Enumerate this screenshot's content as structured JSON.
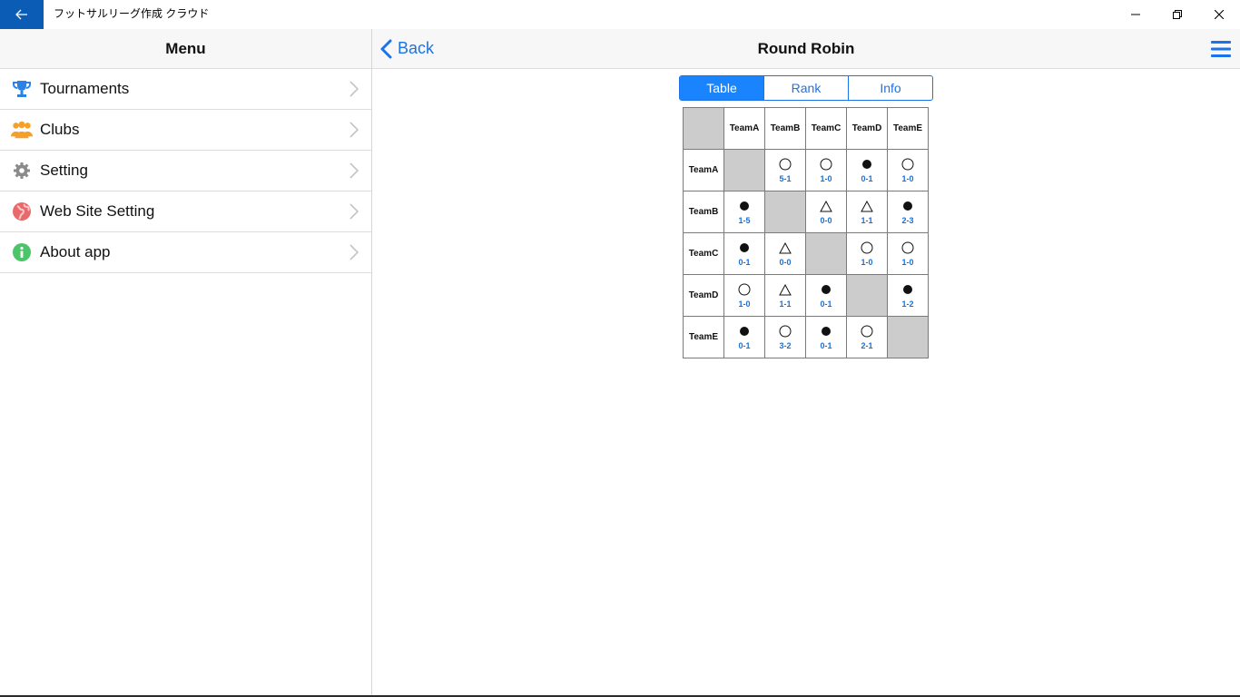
{
  "window": {
    "title": "フットサルリーグ作成 クラウド"
  },
  "menu": {
    "title": "Menu",
    "items": [
      {
        "label": "Tournaments",
        "icon": "trophy-icon",
        "color": "#2a82e4"
      },
      {
        "label": "Clubs",
        "icon": "people-icon",
        "color": "#f5a02a"
      },
      {
        "label": "Setting",
        "icon": "gear-icon",
        "color": "#8a8a8a"
      },
      {
        "label": "Web Site Setting",
        "icon": "globe-icon",
        "color": "#e86a6a"
      },
      {
        "label": "About app",
        "icon": "info-icon",
        "color": "#4cc46a"
      }
    ]
  },
  "nav": {
    "back_label": "Back",
    "title": "Round Robin"
  },
  "tabs": [
    {
      "label": "Table",
      "active": true
    },
    {
      "label": "Rank",
      "active": false
    },
    {
      "label": "Info",
      "active": false
    }
  ],
  "table": {
    "teams": [
      "TeamA",
      "TeamB",
      "TeamC",
      "TeamD",
      "TeamE"
    ],
    "rows": [
      [
        null,
        {
          "result": "win",
          "score": "5-1"
        },
        {
          "result": "win",
          "score": "1-0"
        },
        {
          "result": "loss",
          "score": "0-1"
        },
        {
          "result": "win",
          "score": "1-0"
        }
      ],
      [
        {
          "result": "loss",
          "score": "1-5"
        },
        null,
        {
          "result": "draw",
          "score": "0-0"
        },
        {
          "result": "draw",
          "score": "1-1"
        },
        {
          "result": "loss",
          "score": "2-3"
        }
      ],
      [
        {
          "result": "loss",
          "score": "0-1"
        },
        {
          "result": "draw",
          "score": "0-0"
        },
        null,
        {
          "result": "win",
          "score": "1-0"
        },
        {
          "result": "win",
          "score": "1-0"
        }
      ],
      [
        {
          "result": "win",
          "score": "1-0"
        },
        {
          "result": "draw",
          "score": "1-1"
        },
        {
          "result": "loss",
          "score": "0-1"
        },
        null,
        {
          "result": "loss",
          "score": "1-2"
        }
      ],
      [
        {
          "result": "loss",
          "score": "0-1"
        },
        {
          "result": "win",
          "score": "3-2"
        },
        {
          "result": "loss",
          "score": "0-1"
        },
        {
          "result": "win",
          "score": "2-1"
        },
        null
      ]
    ]
  },
  "colors": {
    "accent": "#1a73e8",
    "titlebar_back": "#0a5cb4",
    "score": "#1a6fd6",
    "diagonal": "#cccccc"
  }
}
